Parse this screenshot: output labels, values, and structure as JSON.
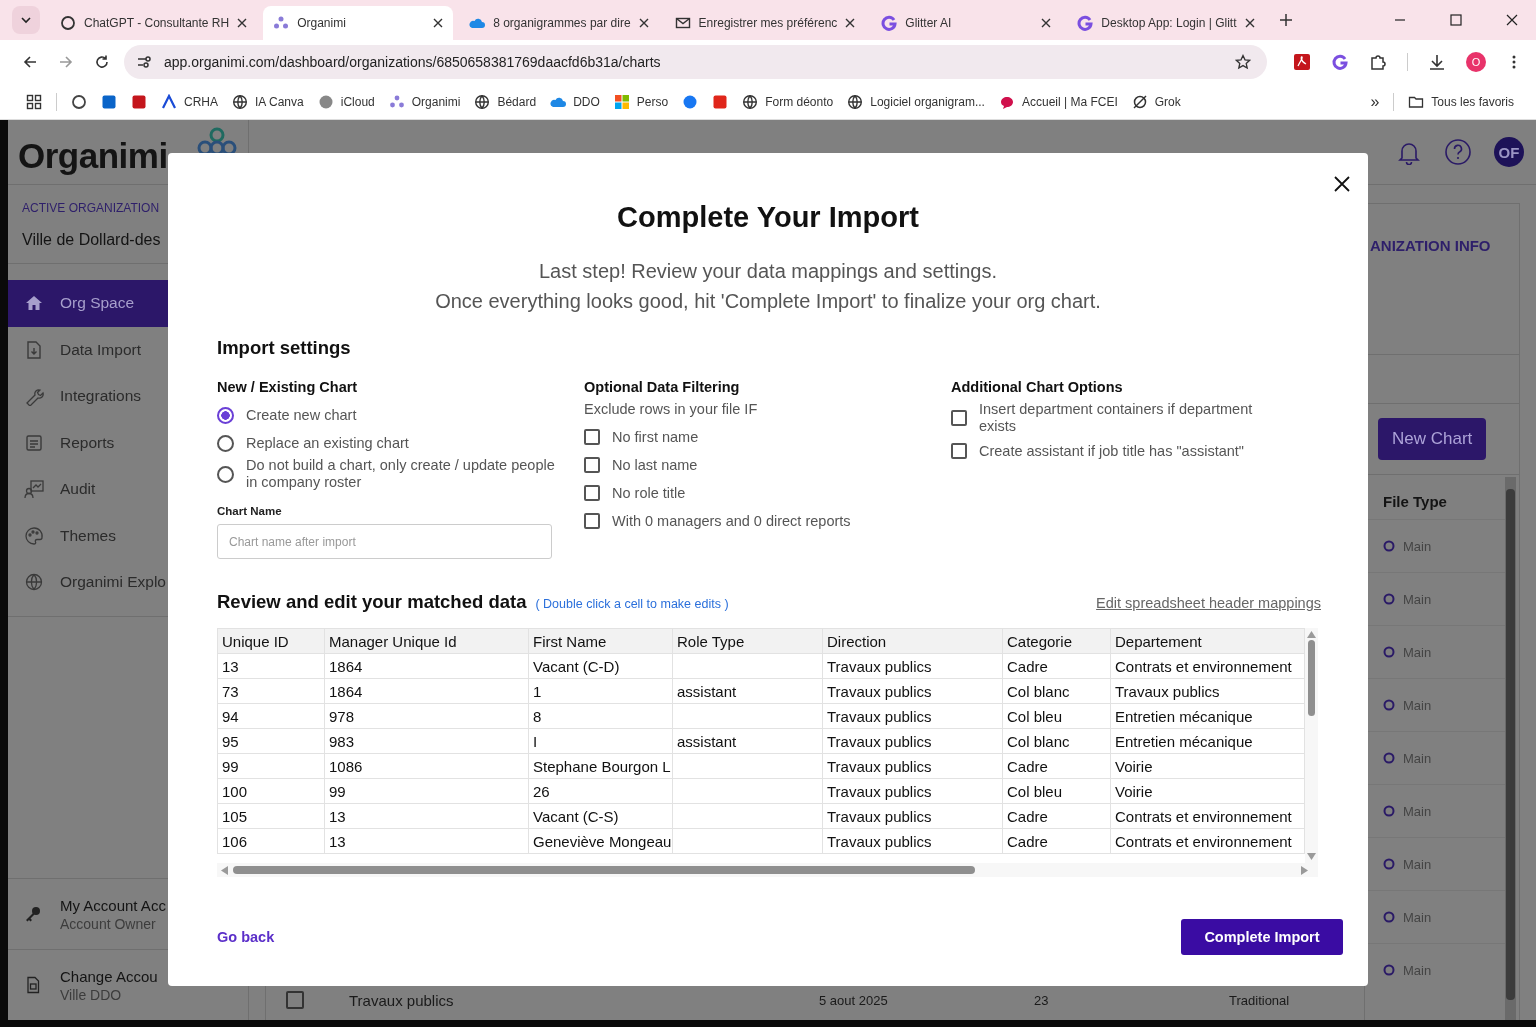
{
  "browser": {
    "tabs": [
      {
        "title": "ChatGPT - Consultante RH",
        "selected": false
      },
      {
        "title": "Organimi",
        "selected": true
      },
      {
        "title": "8 organigrammes par dire",
        "selected": false
      },
      {
        "title": "Enregistrer mes préférenc",
        "selected": false
      },
      {
        "title": "Glitter AI",
        "selected": false
      },
      {
        "title": "Desktop App: Login | Glitt",
        "selected": false
      }
    ],
    "url": "app.organimi.com/dashboard/organizations/6850658381769daacfd6b31a/charts",
    "profile_initial": "O",
    "bookmarks": [
      {
        "kind": "icon"
      },
      {
        "kind": "icon"
      },
      {
        "kind": "icon"
      },
      {
        "kind": "link",
        "label": "CRHA"
      },
      {
        "kind": "link",
        "label": "IA Canva"
      },
      {
        "kind": "link",
        "label": "iCloud"
      },
      {
        "kind": "link",
        "label": "Organimi"
      },
      {
        "kind": "link",
        "label": "Bédard"
      },
      {
        "kind": "link",
        "label": "DDO"
      },
      {
        "kind": "link",
        "label": "Perso"
      },
      {
        "kind": "icon"
      },
      {
        "kind": "icon"
      },
      {
        "kind": "link",
        "label": "Form déonto"
      },
      {
        "kind": "link",
        "label": "Logiciel organigram..."
      },
      {
        "kind": "link",
        "label": "Accueil | Ma FCEI"
      },
      {
        "kind": "link",
        "label": "Grok"
      }
    ],
    "overflow": "»",
    "all_bookmarks": "Tous les favoris"
  },
  "app": {
    "logo": "Organimi",
    "active_org_label": "ACTIVE ORGANIZATION",
    "active_org": "Ville de Dollard-des",
    "nav": [
      {
        "label": "Org Space",
        "selected": true
      },
      {
        "label": "Data Import",
        "selected": false
      },
      {
        "label": "Integrations",
        "selected": false
      },
      {
        "label": "Reports",
        "selected": false
      },
      {
        "label": "Audit",
        "selected": false
      },
      {
        "label": "Themes",
        "selected": false
      },
      {
        "label": "Organimi Explo",
        "selected": false
      }
    ],
    "account": [
      {
        "title": "My Account Acc",
        "subtitle": "Account Owner"
      },
      {
        "title": "Change Accou",
        "subtitle": "Ville DDO"
      }
    ],
    "avatar": "OF",
    "panel_heading": "ANIZATION INFO",
    "new_chart": "New Chart",
    "file_type_header": "File Type",
    "file_types": [
      "Main",
      "Main",
      "Main",
      "Main",
      "Main",
      "Main",
      "Main",
      "Main",
      "Main"
    ],
    "chart_row": {
      "name": "Travaux publics",
      "checked": false,
      "date": "5 aout 2025",
      "count": "23",
      "type": "Traditional"
    }
  },
  "modal": {
    "title": "Complete Your Import",
    "subtitle": [
      "Last step! Review your data mappings and settings.",
      "Once everything looks good, hit 'Complete Import' to finalize your org chart."
    ],
    "settings_heading": "Import settings",
    "chart_mode": {
      "heading": "New / Existing Chart",
      "options": [
        {
          "label": "Create new chart",
          "selected": true
        },
        {
          "label": "Replace an existing chart",
          "selected": false
        },
        {
          "label": "Do not build a chart, only create / update people in company roster",
          "selected": false
        }
      ]
    },
    "chart_name": {
      "label": "Chart Name",
      "placeholder": "Chart name after import"
    },
    "filtering": {
      "heading": "Optional Data Filtering",
      "note": "Exclude rows in your file IF",
      "options": [
        {
          "label": "No first name",
          "checked": false
        },
        {
          "label": "No last name",
          "checked": false
        },
        {
          "label": "No role title",
          "checked": false
        },
        {
          "label": "With 0 managers and 0 direct reports",
          "checked": false
        }
      ]
    },
    "additional": {
      "heading": "Additional Chart Options",
      "options": [
        {
          "label": "Insert department containers if department exists",
          "checked": false
        },
        {
          "label": "Create assistant if job title has \"assistant\"",
          "checked": false
        }
      ]
    },
    "review_heading": "Review and edit your matched data",
    "review_hint": "( Double click a cell to make edits )",
    "edit_mappings": "Edit spreadsheet header mappings",
    "table": {
      "columns": [
        "Unique ID",
        "Manager Unique Id",
        "First Name",
        "Role Type",
        "Direction",
        "Categorie",
        "Departement"
      ],
      "rows": [
        [
          "13",
          "1864",
          "Vacant (C-D)",
          "",
          "Travaux publics",
          "Cadre",
          "Contrats et environnement"
        ],
        [
          "73",
          "1864",
          "1",
          "assistant",
          "Travaux publics",
          "Col blanc",
          "Travaux publics"
        ],
        [
          "94",
          "978",
          "8",
          "",
          "Travaux publics",
          "Col bleu",
          "Entretien mécanique"
        ],
        [
          "95",
          "983",
          "I",
          "assistant",
          "Travaux publics",
          "Col blanc",
          "Entretien mécanique"
        ],
        [
          "99",
          "1086",
          "Stephane Bourgon L",
          "",
          "Travaux publics",
          "Cadre",
          "Voirie"
        ],
        [
          "100",
          "99",
          "26",
          "",
          "Travaux publics",
          "Col bleu",
          "Voirie"
        ],
        [
          "105",
          "13",
          "Vacant (C-S)",
          "",
          "Travaux publics",
          "Cadre",
          "Contrats et environnement"
        ],
        [
          "106",
          "13",
          "Geneviève Mongeau",
          "",
          "Travaux publics",
          "Cadre",
          "Contrats et environnement"
        ]
      ]
    },
    "go_back": "Go back",
    "complete": "Complete Import"
  }
}
